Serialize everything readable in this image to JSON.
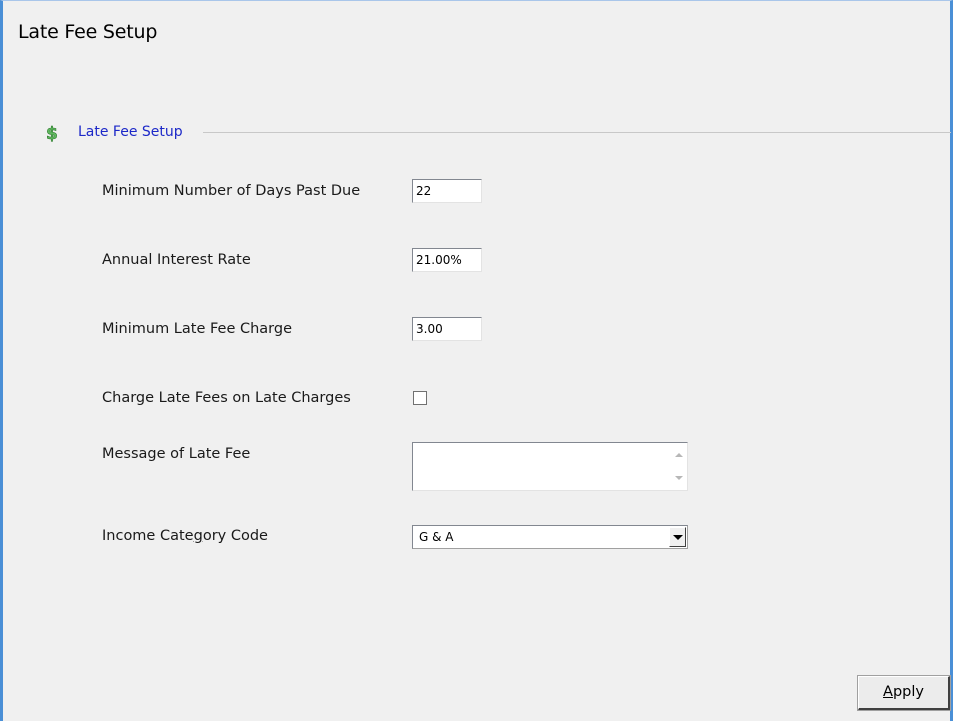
{
  "window": {
    "title": "Late Fee Setup"
  },
  "group": {
    "icon": "dollar-sign-icon",
    "label": "Late Fee Setup"
  },
  "fields": {
    "min_days": {
      "label": "Minimum Number of Days Past Due",
      "value": "22"
    },
    "interest_rate": {
      "label": "Annual Interest Rate",
      "value": "21.00%"
    },
    "min_charge": {
      "label": "Minimum Late Fee Charge",
      "value": "3.00"
    },
    "charge_on_late": {
      "label": "Charge Late Fees on Late Charges",
      "checked": false
    },
    "message": {
      "label": "Message of Late Fee",
      "value": ""
    },
    "income_category": {
      "label_before": "Income Cate",
      "label_underlined": "g",
      "label_mid": "o",
      "label_after": "ry Code",
      "value": "G & A"
    }
  },
  "buttons": {
    "apply": {
      "underlined": "A",
      "rest": "pply"
    }
  },
  "colors": {
    "window_border": "#4a8fd6",
    "group_label": "#1c28c8",
    "icon_green": "#3a9a3a"
  }
}
